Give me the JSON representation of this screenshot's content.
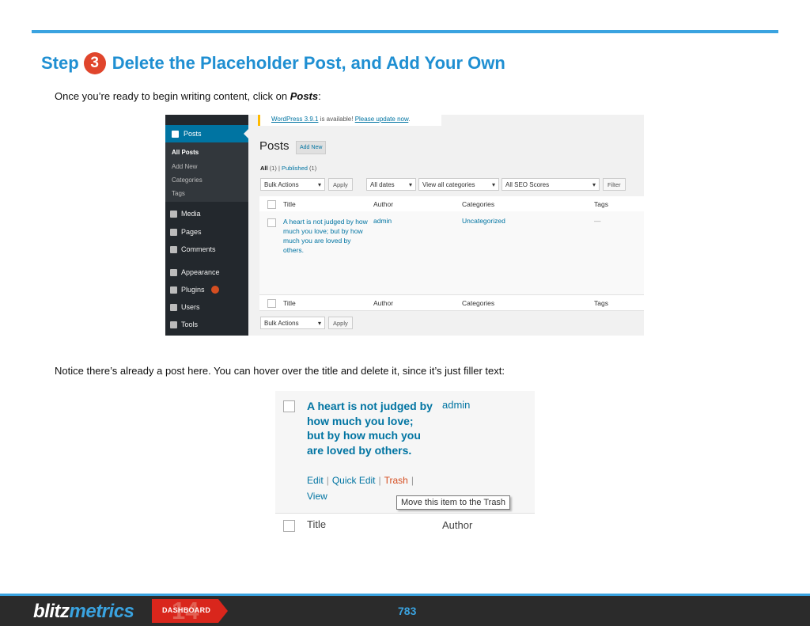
{
  "heading": {
    "step_word": "Step",
    "step_number": "3",
    "title": "Delete the Placeholder Post, and Add Your Own"
  },
  "intro": {
    "text": "Once you’re ready to begin writing content, click on ",
    "emphasis": "Posts",
    "tail": ":"
  },
  "notice_para": "Notice there’s already a post here. You can hover over the title and delete it, since it’s just filler text:",
  "wp_screenshot": {
    "sidebar": {
      "active": "Posts",
      "submenu": [
        "All Posts",
        "Add New",
        "Categories",
        "Tags"
      ],
      "items": [
        {
          "label": "Media",
          "icon": "media-icon"
        },
        {
          "label": "Pages",
          "icon": "pages-icon"
        },
        {
          "label": "Comments",
          "icon": "comments-icon"
        },
        {
          "label": "Appearance",
          "icon": "appearance-icon"
        },
        {
          "label": "Plugins",
          "icon": "plugins-icon",
          "badge": "2"
        },
        {
          "label": "Users",
          "icon": "users-icon"
        },
        {
          "label": "Tools",
          "icon": "tools-icon"
        }
      ]
    },
    "notice": {
      "prefix": "WordPress 3.9.1",
      "middle": " is available! ",
      "link": "Please update now",
      "suffix": "."
    },
    "title": "Posts",
    "add_new": "Add New",
    "filters": {
      "all": "All",
      "all_count": "(1)",
      "sep": "|",
      "published": "Published",
      "published_count": "(1)"
    },
    "controls": {
      "bulk_actions": "Bulk Actions",
      "apply": "Apply",
      "all_dates": "All dates",
      "all_categories": "View all categories",
      "seo_scores": "All SEO Scores",
      "filter": "Filter"
    },
    "columns": [
      "Title",
      "Author",
      "Categories",
      "Tags"
    ],
    "row": {
      "title": "A heart is not judged by how much you love; but by how much you are loved by others.",
      "author": "admin",
      "category": "Uncategorized",
      "tags": "—"
    }
  },
  "zoomed_row": {
    "title": "A heart is not judged by how much you love; but by how much you are loved by others.",
    "author": "admin",
    "actions": {
      "edit": "Edit",
      "quick_edit": "Quick Edit",
      "trash": "Trash",
      "sep": "|",
      "view": "View"
    },
    "tooltip": "Move this item to the Trash",
    "footer_title": "Title",
    "footer_author": "Author"
  },
  "footer": {
    "logo_part1": "blitz",
    "logo_part2": "metrics",
    "tag_number": "14",
    "tag_text": "DASHBOARD",
    "page_number": "783"
  },
  "colors": {
    "accent_blue": "#3aa3e0",
    "step_red": "#e0452c",
    "wp_link": "#0074a2",
    "wp_sidebar": "#23282d",
    "footer_bg": "#2b2b2b"
  }
}
